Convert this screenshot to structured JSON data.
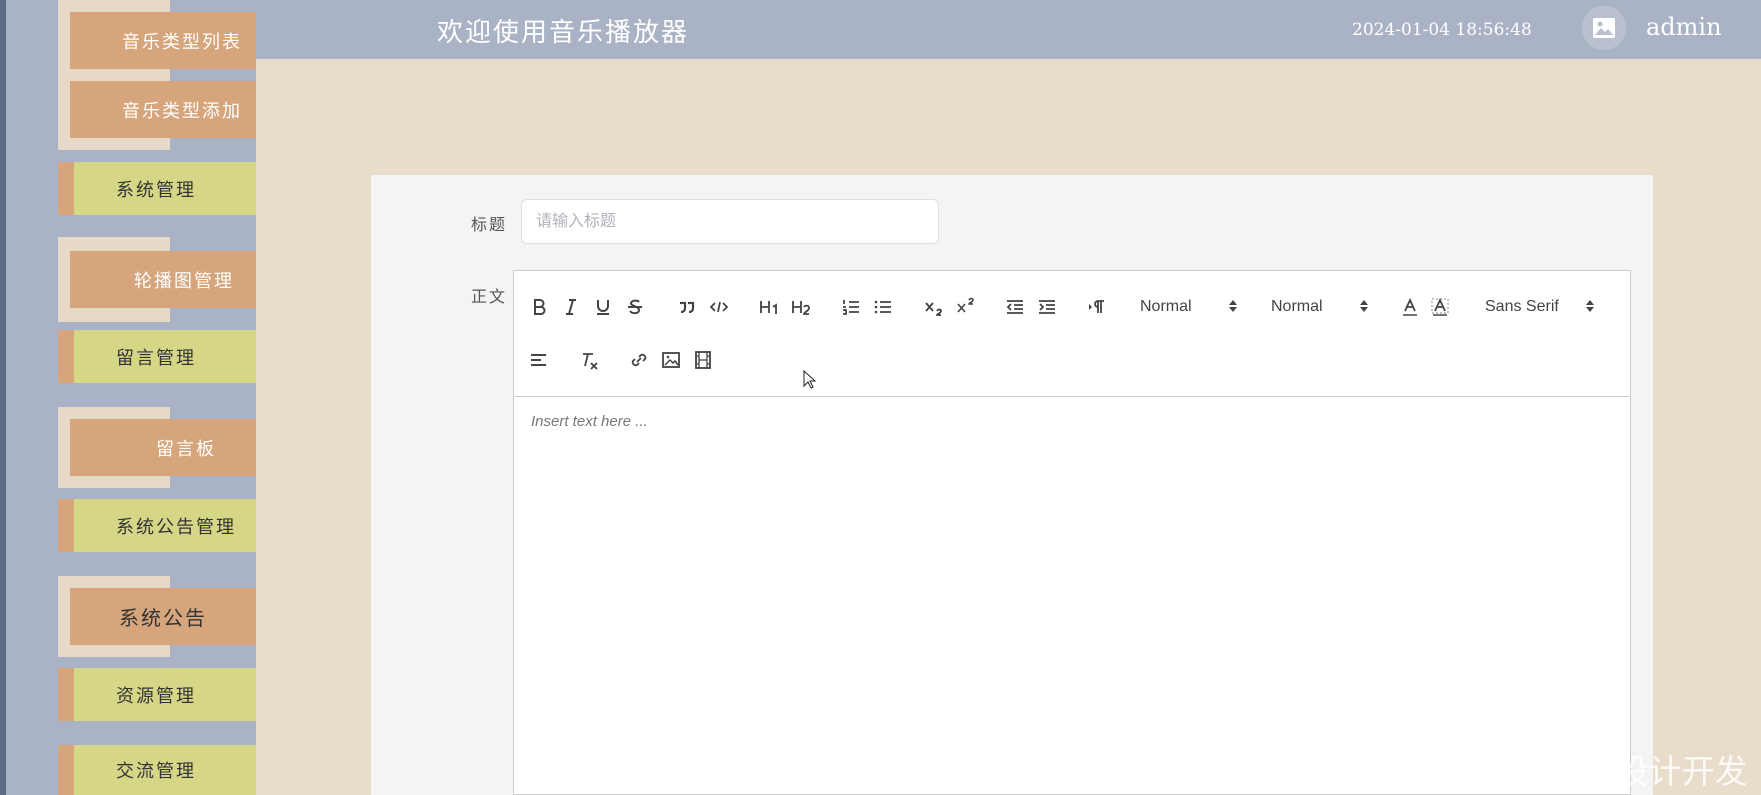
{
  "header": {
    "title": "欢迎使用音乐播放器",
    "datetime": "2024-01-04 18:56:48",
    "user": "admin"
  },
  "sidebar": {
    "items": [
      {
        "label": "音乐类型列表",
        "kind": "sub"
      },
      {
        "label": "音乐类型添加",
        "kind": "sub"
      },
      {
        "label": "系统管理",
        "kind": "main"
      },
      {
        "label": "轮播图管理",
        "kind": "sub"
      },
      {
        "label": "留言管理",
        "kind": "main"
      },
      {
        "label": "留言板",
        "kind": "sub"
      },
      {
        "label": "系统公告管理",
        "kind": "main"
      },
      {
        "label": "系统公告",
        "kind": "sub"
      },
      {
        "label": "资源管理",
        "kind": "main"
      },
      {
        "label": "交流管理",
        "kind": "main"
      }
    ]
  },
  "form": {
    "title_label": "标题",
    "title_placeholder": "请输入标题",
    "title_value": "",
    "body_label": "正文",
    "editor_placeholder": "Insert text here ..."
  },
  "toolbar": {
    "header_picker": "Normal",
    "size_picker": "Normal",
    "font_picker": "Sans Serif"
  },
  "watermark": "CSDN @计算机毕业设计开发",
  "colors": {
    "sidebar_bg": "#aab3c5",
    "page_bg": "#e8dccb",
    "sub_button": "#d6a57c",
    "main_button": "#d6d786"
  }
}
